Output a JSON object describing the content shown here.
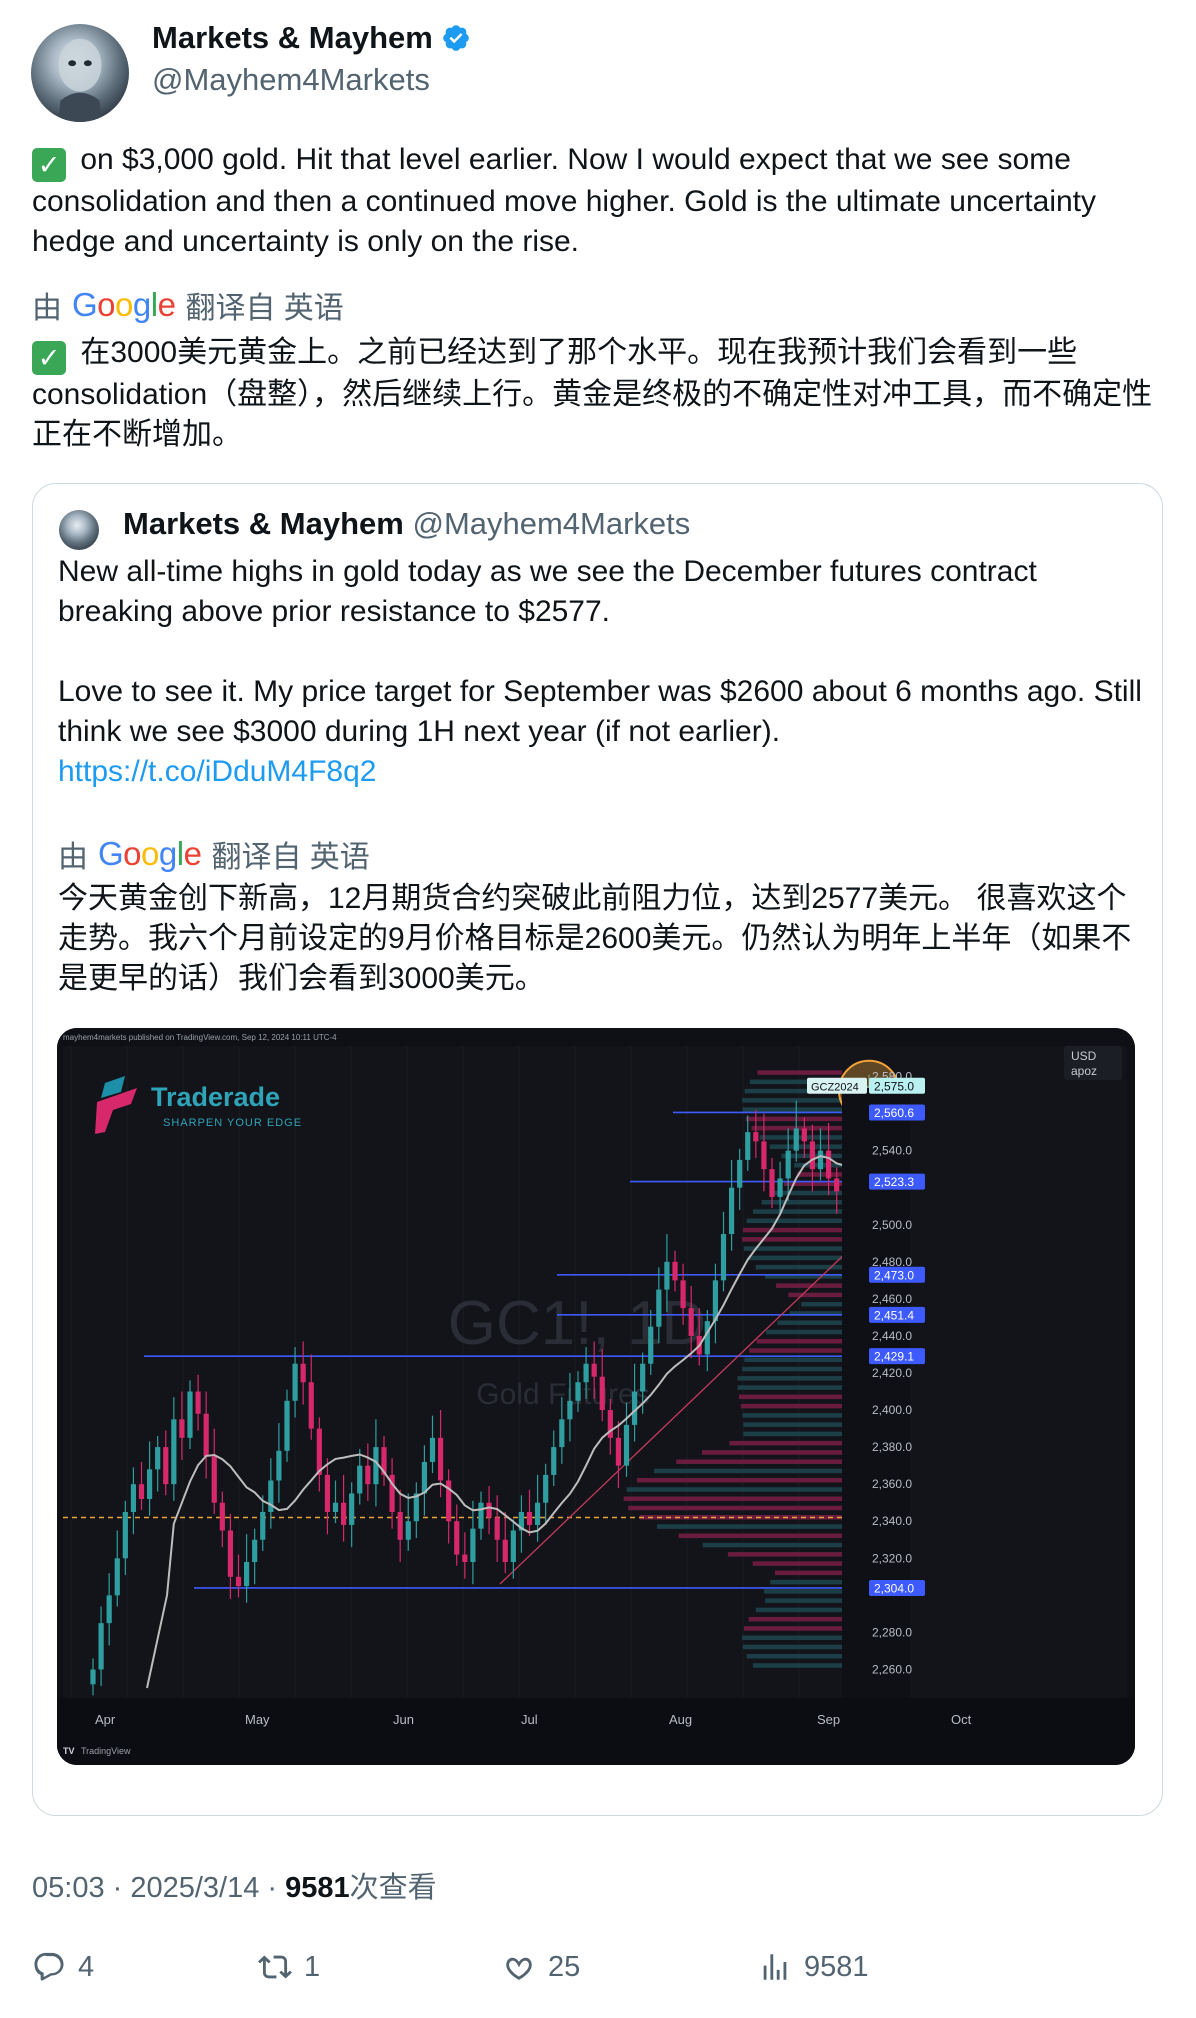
{
  "author": {
    "display_name": "Markets & Mayhem",
    "handle": "@Mayhem4Markets",
    "verified": true
  },
  "tweet": {
    "text": " on $3,000 gold. Hit that level earlier. Now I would expect that we see some consolidation and then a continued move higher. Gold is the ultimate uncertainty hedge and uncertainty is only on the rise.",
    "translation_prefix": "由",
    "translation_suffix": "翻译自 英语",
    "translated_text": " 在3000美元黄金上。之前已经达到了那个水平。现在我预计我们会看到一些consolidation（盘整），然后继续上行。黄金是终极的不确定性对冲工具，而不确定性正在不断增加。"
  },
  "quote": {
    "display_name": "Markets & Mayhem",
    "handle": "@Mayhem4Markets",
    "text_line1": "New all-time highs in gold today as we see the December futures contract breaking above prior resistance to $2577.",
    "text_line2": "Love to see it. My price target for September was $2600 about 6 months ago. Still think we see $3000 during 1H next year (if not earlier).",
    "link": "https://t.co/iDduM4F8q2",
    "translation_prefix": "由",
    "translation_suffix": "翻译自 英语",
    "translated_text": "今天黄金创下新高，12月期货合约突破此前阻力位，达到2577美元。 很喜欢这个走势。我六个月前设定的9月价格目标是2600美元。仍然认为明年上半年（如果不是更早的话）我们会看到3000美元。"
  },
  "chart_image": {
    "publisher_note": "mayhem4markets published on TradingView.com, Sep 12, 2024 10:11 UTC-4",
    "brand": "Traderade",
    "brand_tagline": "SHARPEN YOUR EDGE",
    "watermark_symbol": "GC1!, 1D",
    "watermark_name": "Gold Futures",
    "currency": "USD",
    "currency_sub": "apoz",
    "ticker_tag": "GCZ2024",
    "last_price": "2,575.0",
    "footer_brand": "TradingView"
  },
  "chart_data": {
    "type": "candlestick",
    "title": "",
    "x_ticks": [
      "Apr",
      "May",
      "Jun",
      "Jul",
      "Aug",
      "Sep",
      "Oct"
    ],
    "y_ticks": [
      "2,580.0",
      "2,540.0",
      "2,500.0",
      "2,480.0",
      "2,460.0",
      "2,440.0",
      "2,420.0",
      "2,400.0",
      "2,380.0",
      "2,360.0",
      "2,340.0",
      "2,320.0",
      "2,280.0",
      "2,260.0"
    ],
    "ylim": [
      2250,
      2590
    ],
    "price_levels": [
      "2,560.6",
      "2,523.3",
      "2,473.0",
      "2,451.4",
      "2,429.1",
      "2,304.0"
    ],
    "level_values": [
      2560.6,
      2523.3,
      2473.0,
      2451.4,
      2429.1,
      2304.0
    ],
    "dashed_level": 2342,
    "last_value": 2575.0,
    "closes": [
      2260,
      2285,
      2300,
      2320,
      2345,
      2360,
      2352,
      2368,
      2380,
      2360,
      2395,
      2385,
      2410,
      2398,
      2375,
      2350,
      2335,
      2310,
      2305,
      2318,
      2330,
      2345,
      2362,
      2378,
      2405,
      2425,
      2415,
      2390,
      2365,
      2345,
      2350,
      2338,
      2355,
      2370,
      2360,
      2380,
      2365,
      2345,
      2330,
      2340,
      2355,
      2372,
      2385,
      2362,
      2340,
      2322,
      2318,
      2336,
      2350,
      2342,
      2330,
      2318,
      2335,
      2345,
      2338,
      2350,
      2365,
      2380,
      2395,
      2405,
      2415,
      2425,
      2418,
      2400,
      2385,
      2370,
      2392,
      2410,
      2425,
      2445,
      2465,
      2480,
      2470,
      2455,
      2440,
      2430,
      2448,
      2470,
      2495,
      2520,
      2535,
      2550,
      2545,
      2530,
      2515,
      2525,
      2540,
      2552,
      2545,
      2530,
      2540,
      2525,
      2518,
      2530,
      2545,
      2560,
      2575
    ]
  },
  "stats": {
    "timestamp": "05:03 · 2025/3/14 · ",
    "views": "9581",
    "views_label": "次查看",
    "replies": "4",
    "reposts": "1",
    "likes": "25",
    "view_count": "9581"
  },
  "icons": {
    "verified": "verified-badge-icon",
    "check": "check-mark-icon",
    "reply": "reply-icon",
    "repost": "repost-icon",
    "like": "heart-icon",
    "views": "views-bar-chart-icon"
  },
  "colors": {
    "link": "#1d9bf0",
    "verified": "#1d9bf0",
    "check": "#3aa757",
    "candle_up": "#2f9ea0",
    "candle_down": "#d6286a",
    "level_line": "#3d5afe"
  }
}
